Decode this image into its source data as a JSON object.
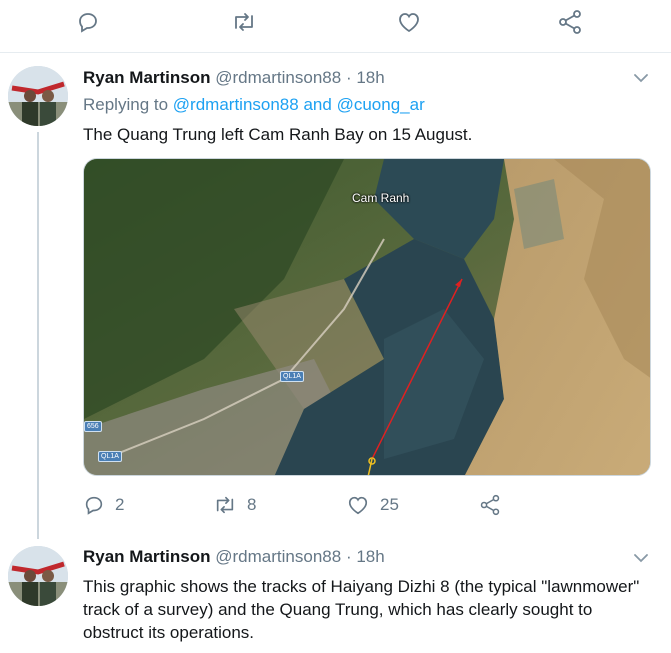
{
  "top_actions": {
    "icons": [
      "reply-icon",
      "retweet-icon",
      "like-icon",
      "share-icon"
    ]
  },
  "tweets": [
    {
      "name": "Ryan Martinson",
      "handle": "@rdmartinson88",
      "separator": "·",
      "time": "18h",
      "replying_prefix": "Replying to",
      "replying_to_1": "@rdmartinson88",
      "replying_and": "and",
      "replying_to_2": "@cuong_ar",
      "text": "The Quang Trung left Cam Ranh Bay on 15 August.",
      "media": {
        "place_label": "Cam Ranh",
        "road_labels": [
          "QL1A",
          "QL1A",
          "656"
        ]
      },
      "metrics": {
        "replies": "2",
        "retweets": "8",
        "likes": "25"
      }
    },
    {
      "name": "Ryan Martinson",
      "handle": "@rdmartinson88",
      "separator": "·",
      "time": "18h",
      "text": "This graphic shows the tracks of Haiyang Dizhi 8 (the typical \"lawnmower\" track of a survey) and the Quang Trung, which has clearly sought to obstruct its operations."
    }
  ],
  "colors": {
    "icon_gray": "#657786",
    "link_blue": "#1da1f2",
    "track_red": "#e02020",
    "track_yellow": "#f0c020"
  }
}
